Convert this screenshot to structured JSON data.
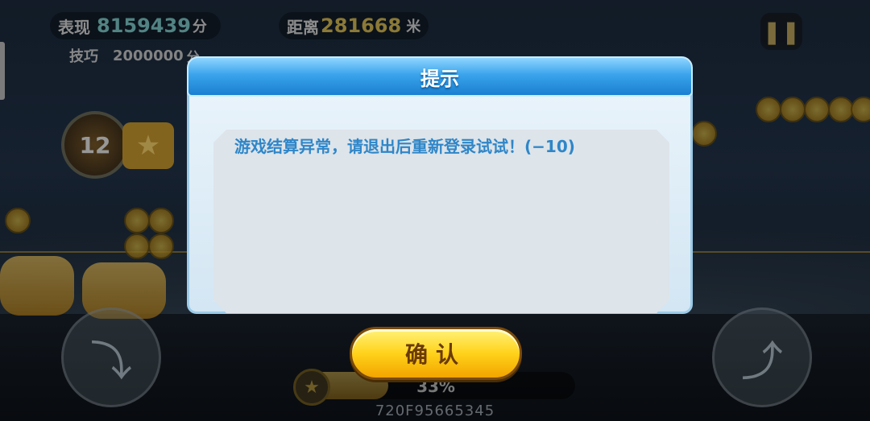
{
  "hud": {
    "score_label": "表现",
    "score_value": "8159439",
    "score_unit": "分",
    "skill_label": "技巧",
    "skill_value": "2000000",
    "skill_unit": "分",
    "distance_label": "距离",
    "distance_value": "281668",
    "distance_unit": "米",
    "pause_icon": "pause-icon"
  },
  "level_badge": "12",
  "progress": {
    "percent_text": "33%",
    "fraction": 0.33
  },
  "device_id": "720F95665345",
  "dialog": {
    "title": "提示",
    "message": "游戏结算异常，请退出后重新登录试试！(−10)",
    "confirm_label": "确认"
  },
  "colors": {
    "dialog_header": "#2f97e2",
    "message_text": "#2f86c8",
    "confirm_button": "#ffd21a"
  }
}
